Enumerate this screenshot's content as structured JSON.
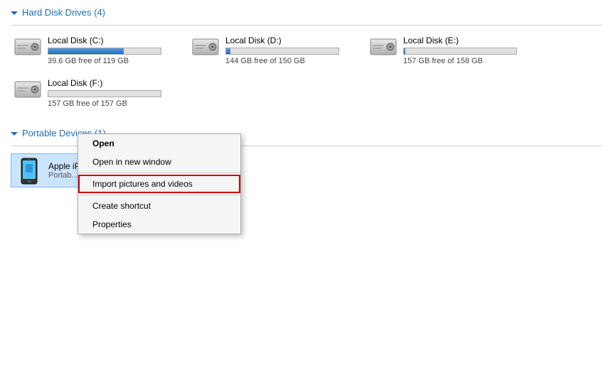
{
  "sections": {
    "hard_disk": {
      "label": "Hard Disk Drives (4)",
      "drives": [
        {
          "name": "Local Disk (C:)",
          "space": "39.6 GB free of 119 GB",
          "fill_percent": 67,
          "near_full": false
        },
        {
          "name": "Local Disk (D:)",
          "space": "144 GB free of 150 GB",
          "fill_percent": 4,
          "near_full": false
        },
        {
          "name": "Local Disk (E:)",
          "space": "157 GB free of 158 GB",
          "fill_percent": 1,
          "near_full": false
        },
        {
          "name": "Local Disk (F:)",
          "space": "157 GB free of 157 GB",
          "fill_percent": 0,
          "near_full": false
        }
      ]
    },
    "portable": {
      "label": "Portable Devices (1)",
      "devices": [
        {
          "name": "Apple iPhone",
          "type": "Portable Media Player"
        }
      ]
    }
  },
  "context_menu": {
    "items": [
      {
        "label": "Open",
        "bold": true,
        "highlighted": false,
        "separator_after": false
      },
      {
        "label": "Open in new window",
        "bold": false,
        "highlighted": false,
        "separator_after": true
      },
      {
        "label": "Import pictures and videos",
        "bold": false,
        "highlighted": true,
        "separator_after": true
      },
      {
        "label": "Create shortcut",
        "bold": false,
        "highlighted": false,
        "separator_after": false
      },
      {
        "label": "Properties",
        "bold": false,
        "highlighted": false,
        "separator_after": false
      }
    ]
  }
}
